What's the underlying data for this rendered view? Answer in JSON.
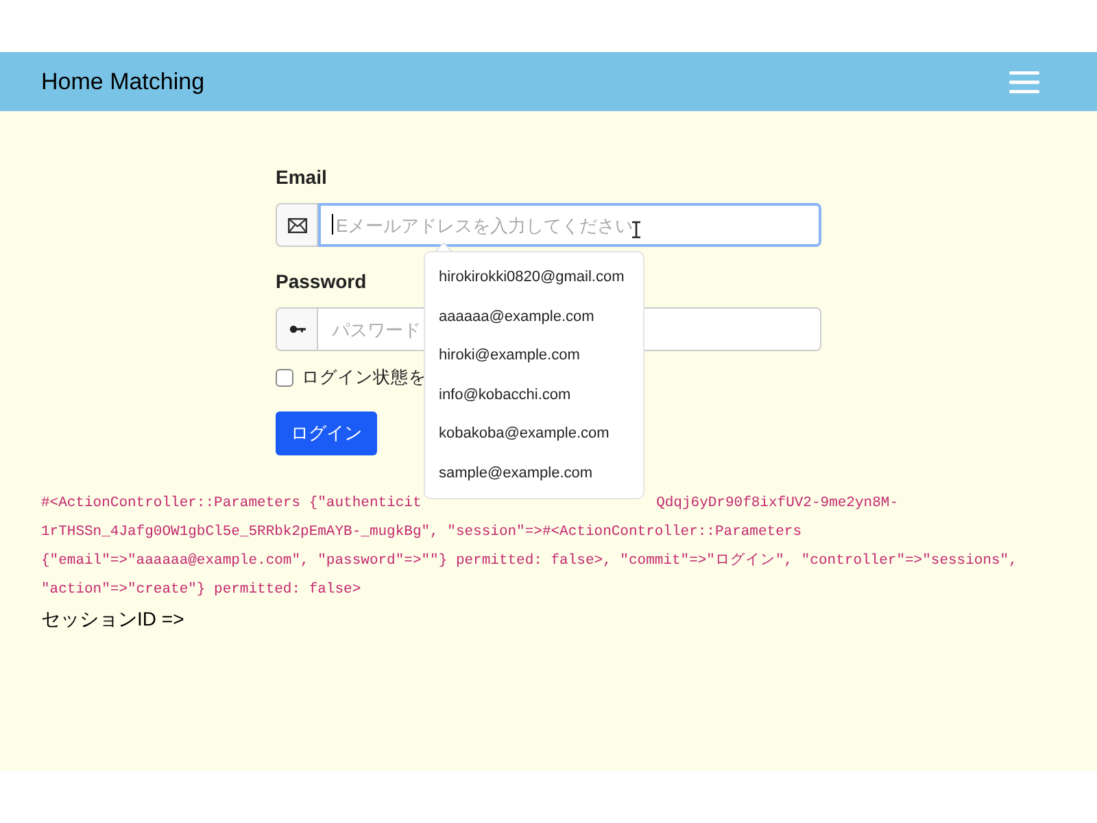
{
  "navbar": {
    "brand": "Home Matching"
  },
  "form": {
    "email": {
      "label": "Email",
      "placeholder": "Eメールアドレスを入力してください",
      "focused": true
    },
    "password": {
      "label": "Password",
      "placeholder": "パスワード"
    },
    "remember": {
      "label": "ログイン状態を",
      "checked": false
    },
    "submit": "ログイン"
  },
  "autocomplete": [
    "hirokirokki0820@gmail.com",
    "aaaaaa@example.com",
    "hiroki@example.com",
    "info@kobacchi.com",
    "kobakoba@example.com",
    "sample@example.com"
  ],
  "debug_lines": [
    [
      "#<ActionController::Parameters {\"authenticit",
      "Qdqj6yDr90f8ixfUV2-9me2yn8M-"
    ],
    [
      "1rTHSSn_4Jafg0OW1gbCl5e_5RRbk2pEmAYB-_mugkBg\", \"session\"=>#<ActionController::Parameters"
    ],
    [
      "{\"email\"=>\"aaaaaa@example.com\", \"password\"=>\"\"} permitted: false>, \"commit\"=>\"ログイン\", \"controller\"=>\"sessions\","
    ],
    [
      "\"action\"=>\"create\"} permitted: false>"
    ]
  ],
  "session_line": "セッションID =>"
}
